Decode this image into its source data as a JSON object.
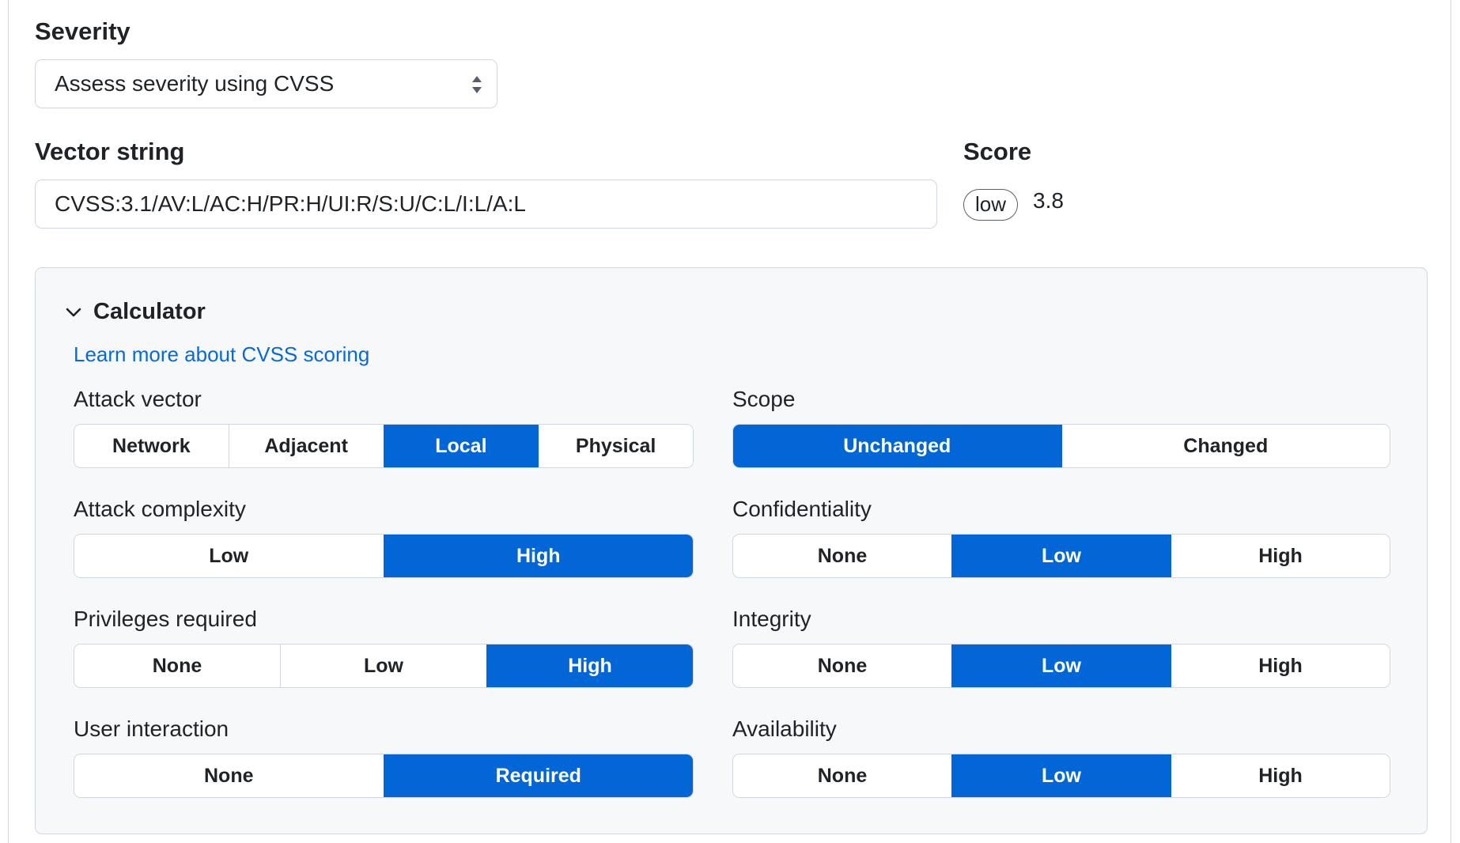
{
  "severity": {
    "label": "Severity",
    "select_value": "Assess severity using CVSS"
  },
  "vector": {
    "label": "Vector string",
    "value": "CVSS:3.1/AV:L/AC:H/PR:H/UI:R/S:U/C:L/I:L/A:L"
  },
  "score": {
    "label": "Score",
    "badge": "low",
    "value": "3.8"
  },
  "calculator": {
    "title": "Calculator",
    "learn_link": "Learn more about CVSS scoring",
    "accent_color": "#0366d6",
    "metrics": {
      "attack_vector": {
        "label": "Attack vector",
        "options": [
          "Network",
          "Adjacent",
          "Local",
          "Physical"
        ],
        "selected": "Local"
      },
      "attack_complexity": {
        "label": "Attack complexity",
        "options": [
          "Low",
          "High"
        ],
        "selected": "High"
      },
      "privileges_required": {
        "label": "Privileges required",
        "options": [
          "None",
          "Low",
          "High"
        ],
        "selected": "High"
      },
      "user_interaction": {
        "label": "User interaction",
        "options": [
          "None",
          "Required"
        ],
        "selected": "Required"
      },
      "scope": {
        "label": "Scope",
        "options": [
          "Unchanged",
          "Changed"
        ],
        "selected": "Unchanged"
      },
      "confidentiality": {
        "label": "Confidentiality",
        "options": [
          "None",
          "Low",
          "High"
        ],
        "selected": "Low"
      },
      "integrity": {
        "label": "Integrity",
        "options": [
          "None",
          "Low",
          "High"
        ],
        "selected": "Low"
      },
      "availability": {
        "label": "Availability",
        "options": [
          "None",
          "Low",
          "High"
        ],
        "selected": "Low"
      }
    }
  }
}
